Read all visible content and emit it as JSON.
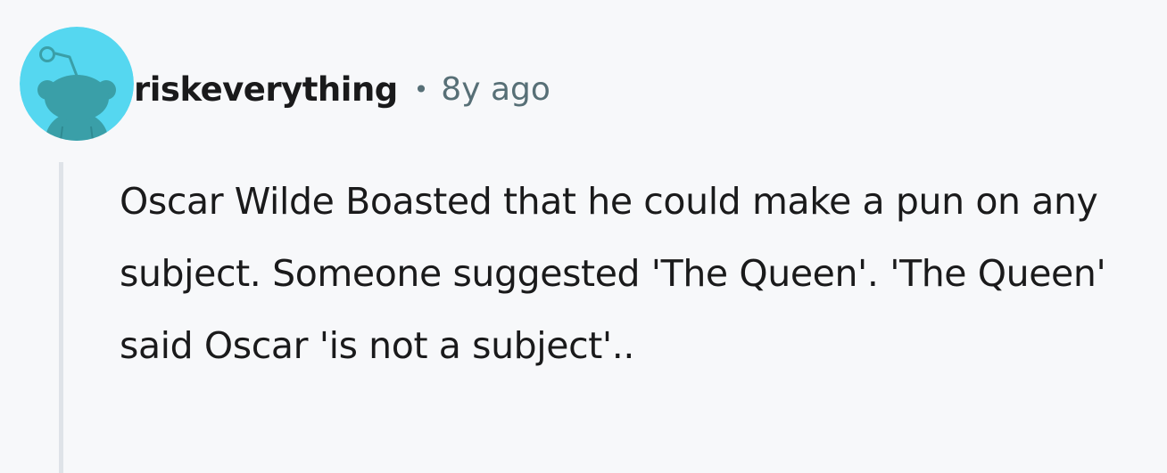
{
  "comment": {
    "author": "riskeverything",
    "separator": "•",
    "timestamp": "8y ago",
    "body": "Oscar Wilde Boasted that he could make a pun on any subject. Someone suggested 'The Queen'. 'The Queen' said Oscar 'is not a subject'..",
    "avatar_icon": "snoo-avatar-icon",
    "colors": {
      "avatar_background": "#55d7f0",
      "avatar_figure": "#3a9fa8",
      "author_text": "#1a1a1b",
      "meta_text": "#576f76",
      "thread_line": "#dfe3e8",
      "page_background": "#f7f8fa"
    }
  }
}
